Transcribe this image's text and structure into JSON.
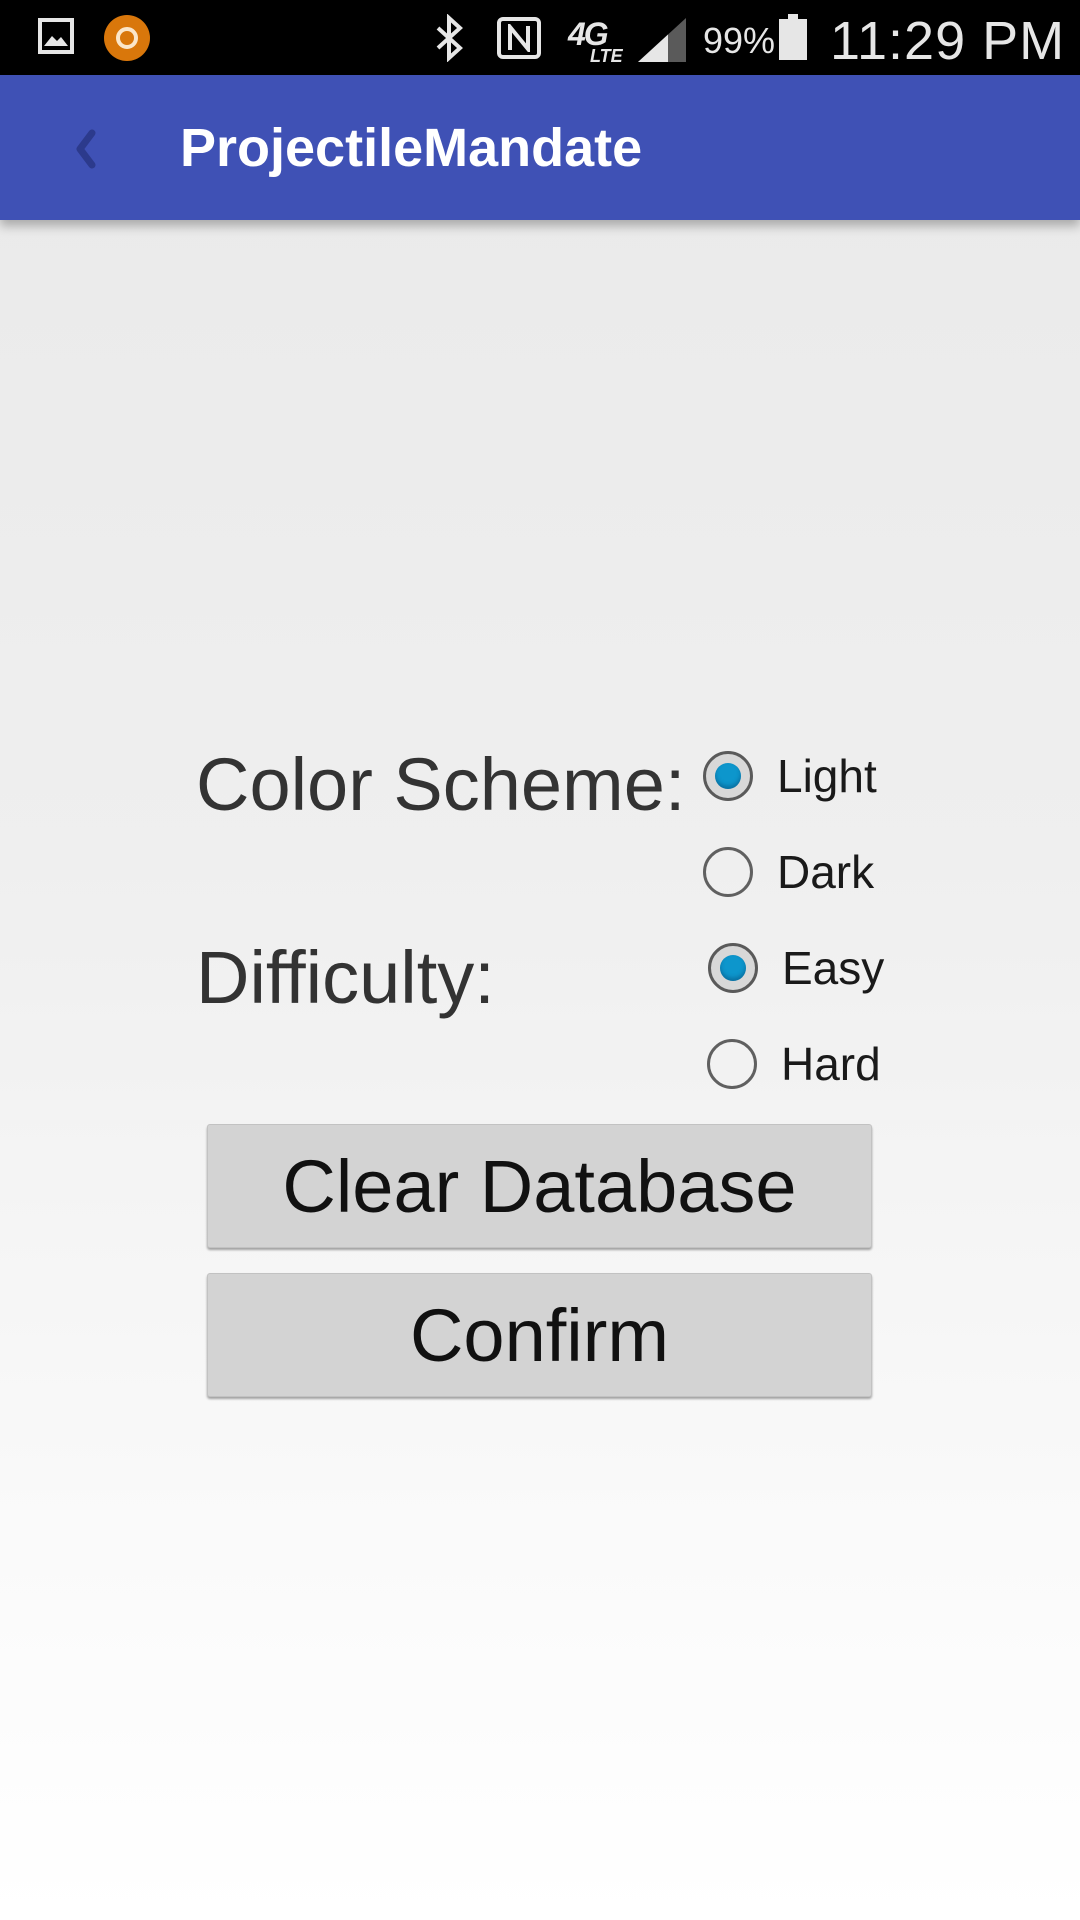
{
  "status_bar": {
    "icons": [
      "gallery-icon",
      "app-badge-icon",
      "bluetooth-icon",
      "nfc-icon",
      "signal-icon",
      "battery-icon"
    ],
    "network_type": "4G",
    "network_subtype": "LTE",
    "battery_percent": "99%",
    "time": "11:29 PM"
  },
  "action_bar": {
    "back_icon": "chevron-left-icon",
    "title": "ProjectileMandate",
    "background_color": "#3f51b5"
  },
  "settings": {
    "color_scheme": {
      "label": "Color Scheme:",
      "options": [
        {
          "label": "Light",
          "checked": true
        },
        {
          "label": "Dark",
          "checked": false
        }
      ]
    },
    "difficulty": {
      "label": "Difficulty:",
      "options": [
        {
          "label": "Easy",
          "checked": true
        },
        {
          "label": "Hard",
          "checked": false
        }
      ]
    }
  },
  "buttons": {
    "clear_database": "Clear Database",
    "confirm": "Confirm"
  },
  "colors": {
    "radio_selected": "#0d96cc",
    "button_background": "#d3d3d3"
  }
}
